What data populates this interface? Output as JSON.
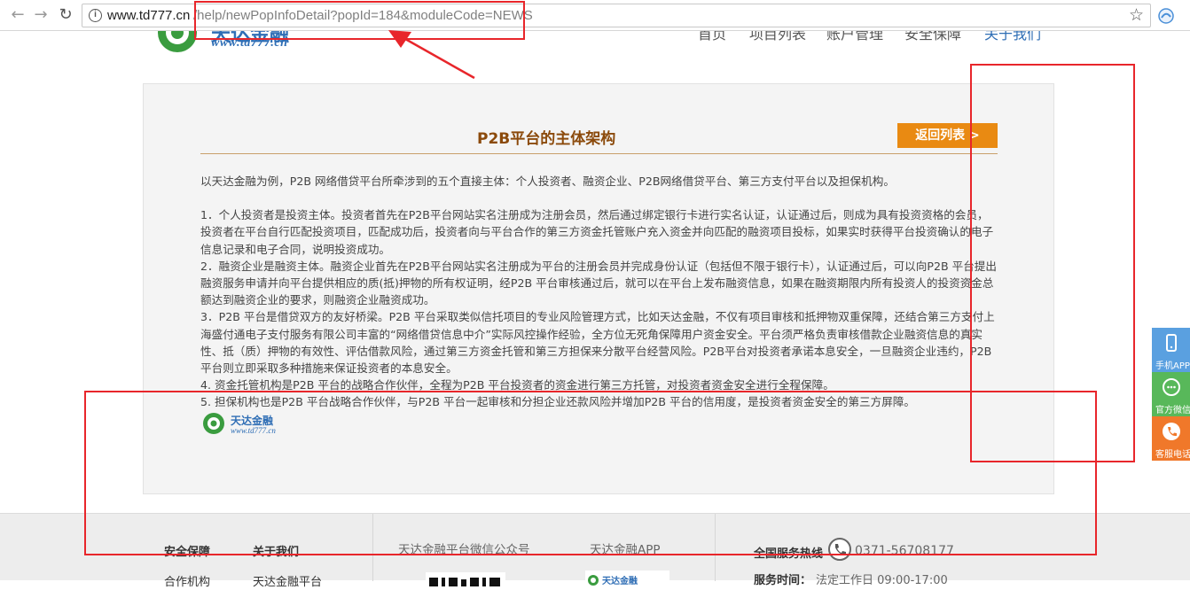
{
  "browser": {
    "url_host": "www.td777.cn",
    "url_path": "/help/newPopInfoDetail?popId=184&moduleCode=NEWS",
    "info_glyph": "i",
    "back_glyph": "←",
    "forward_glyph": "→",
    "reload_glyph": "↻",
    "star_glyph": "☆"
  },
  "header": {
    "logo_name": "天达金融",
    "logo_url": "www.td777.cn",
    "nav": [
      "首页",
      "项目列表",
      "账户管理",
      "安全保障",
      "关于我们"
    ]
  },
  "article": {
    "title": "P2B平台的主体架构",
    "back_button": "返回列表 >",
    "intro": "以天达金融为例，P2B 网络借贷平台所牵涉到的五个直接主体：个人投资者、融资企业、P2B网络借贷平台、第三方支付平台以及担保机构。",
    "items": [
      "1．个人投资者是投资主体。投资者首先在P2B平台网站实名注册成为注册会员，然后通过绑定银行卡进行实名认证，认证通过后，则成为具有投资资格的会员，投资者在平台自行匹配投资项目，匹配成功后，投资者向与平台合作的第三方资金托管账户充入资金并向匹配的融资项目投标，如果实时获得平台投资确认的电子信息记录和电子合同，说明投资成功。",
      "2．融资企业是融资主体。融资企业首先在P2B平台网站实名注册成为平台的注册会员并完成身份认证（包括但不限于银行卡），认证通过后，可以向P2B 平台提出融资服务申请并向平台提供相应的质(抵)押物的所有权证明，经P2B 平台审核通过后，就可以在平台上发布融资信息，如果在融资期限内所有投资人的投资资金总额达到融资企业的要求，则融资企业融资成功。",
      "3．P2B 平台是借贷双方的友好桥梁。P2B 平台采取类似信托项目的专业风险管理方式，比如天达金融，不仅有项目审核和抵押物双重保障，还结合第三方支付上海盛付通电子支付服务有限公司丰富的“网络借贷信息中介”实际风控操作经验，全方位无死角保障用户资金安全。平台须严格负责审核借款企业融资信息的真实性、抵（质）押物的有效性、评估借款风险，通过第三方资金托管和第三方担保来分散平台经营风险。P2B平台对投资者承诺本息安全，一旦融资企业违约，P2B 平台则立即采取多种措施来保证投资者的本息安全。",
      "4. 资金托管机构是P2B 平台的战略合作伙伴，全程为P2B 平台投资者的资金进行第三方托管，对投资者资金安全进行全程保障。",
      "5. 担保机构也是P2B 平台战略合作伙伴，与P2B 平台一起审核和分担企业还款风险并增加P2B 平台的信用度，是投资者资金安全的第三方屏障。"
    ],
    "logo_name": "天达金融",
    "logo_url": "www.td777.cn"
  },
  "footer": {
    "col1_title": "安全保障",
    "col1_item": "合作机构",
    "col2_title": "关于我们",
    "col2_item": "天达金融平台",
    "wechat_label": "天达金融平台微信公众号",
    "app_label": "天达金融APP",
    "hotline_label": "全国服务热线",
    "hotline_number": "0371-56708177",
    "hours_label": "服务时间：",
    "hours_value": "法定工作日 09:00-17:00",
    "app_qr_name": "天达金融"
  },
  "side_float": [
    {
      "label": "手机APP",
      "color": "#5aa0e0",
      "icon": "phone-icon"
    },
    {
      "label": "官方微信",
      "color": "#58b85a",
      "icon": "wechat-icon"
    },
    {
      "label": "客服电话",
      "color": "#f0782a",
      "icon": "call-icon"
    }
  ]
}
